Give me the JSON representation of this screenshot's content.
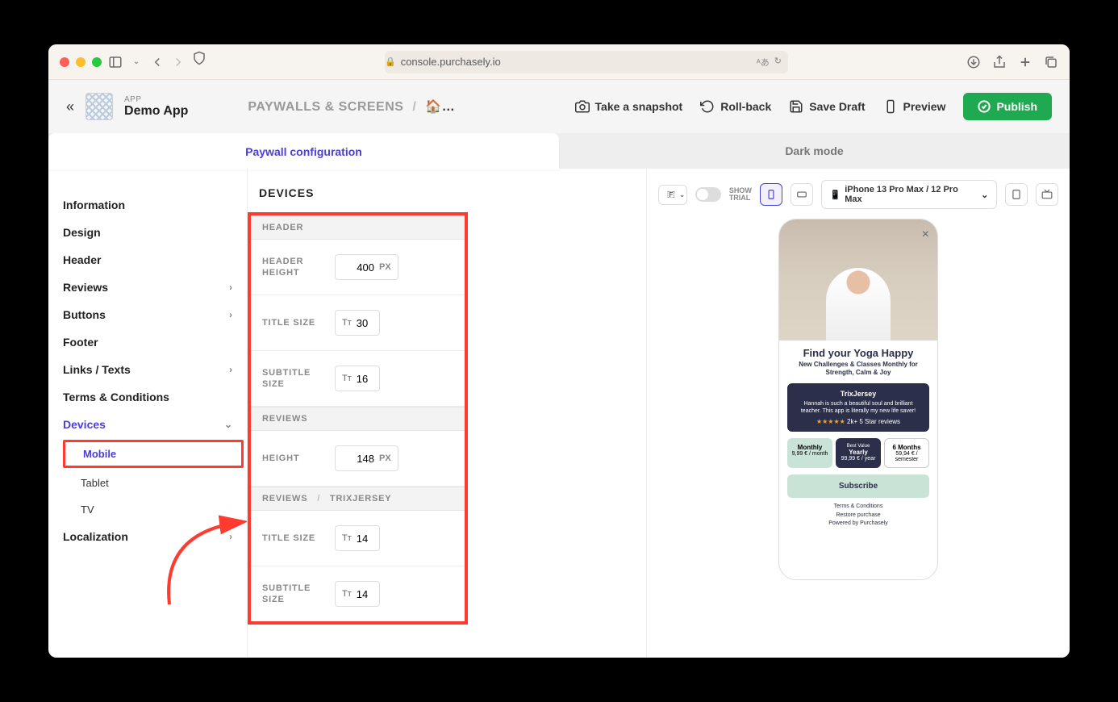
{
  "browser": {
    "url": "console.purchasely.io"
  },
  "app": {
    "label": "APP",
    "name": "Demo App"
  },
  "breadcrumb": {
    "title": "PAYWALLS & SCREENS",
    "sep": "/",
    "page": "🏠…"
  },
  "actions": {
    "snapshot": "Take a snapshot",
    "rollback": "Roll-back",
    "save_draft": "Save Draft",
    "preview": "Preview",
    "publish": "Publish"
  },
  "tabs": {
    "left": "Paywall configuration",
    "right": "Dark mode"
  },
  "sidebar": {
    "information": "Information",
    "design": "Design",
    "header": "Header",
    "reviews": "Reviews",
    "buttons": "Buttons",
    "footer": "Footer",
    "links_texts": "Links / Texts",
    "terms": "Terms & Conditions",
    "devices": "Devices",
    "mobile": "Mobile",
    "tablet": "Tablet",
    "tv": "TV",
    "localization": "Localization"
  },
  "center": {
    "title": "DEVICES",
    "header_section": "HEADER",
    "header_height_label": "HEADER HEIGHT",
    "header_height_value": "400",
    "px": "PX",
    "title_size_label": "TITLE SIZE",
    "title_size_value": "30",
    "subtitle_size_label": "SUBTITLE SIZE",
    "subtitle_size_value": "16",
    "reviews_section": "REVIEWS",
    "height_label": "HEIGHT",
    "height_value": "148",
    "reviews_breadcrumb_a": "REVIEWS",
    "reviews_breadcrumb_b": "TRIXJERSEY",
    "review_title_size_label": "TITLE SIZE",
    "review_title_size_value": "14",
    "review_subtitle_size_label": "SUBTITLE SIZE",
    "review_subtitle_size_value": "14"
  },
  "preview": {
    "show_trial_a": "SHOW",
    "show_trial_b": "TRIAL",
    "device": "iPhone 13 Pro Max / 12 Pro Max",
    "phone": {
      "title": "Find your Yoga Happy",
      "subtitle": "New Challenges & Classes Monthly for Strength, Calm & Joy",
      "review_name": "TrixJersey",
      "review_text": "Hannah is such a beautiful soul and brilliant teacher. This app is literally my new life saver!",
      "stars_text": "2k+ 5 Star reviews",
      "plan1_name": "Monthly",
      "plan1_price": "9,99 € / month",
      "plan2_best": "Best Value",
      "plan2_name": "Yearly",
      "plan2_price": "99,99 € / year",
      "plan3_name": "6 Months",
      "plan3_price": "59,94 € / semester",
      "subscribe": "Subscribe",
      "link1": "Terms & Conditions",
      "link2": "Restore purchase",
      "link3": "Powered by Purchasely"
    }
  }
}
